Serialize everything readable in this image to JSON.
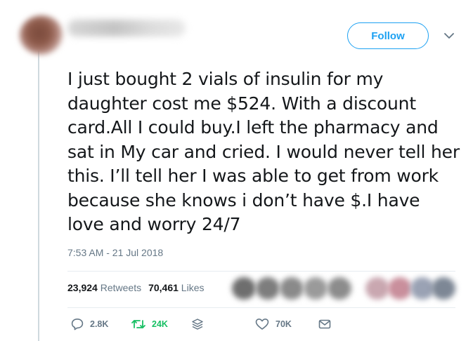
{
  "header": {
    "follow_label": "Follow"
  },
  "tweet": {
    "text": "I just bought 2 vials of insulin for my daughter cost me $524. With a discount card.All I could buy.I left the pharmacy and sat in My car and cried. I would never tell her this. I’ll  tell her I was able to get from work because she knows i don’t have $.I have love and worry 24/7",
    "timestamp": "7:53 AM - 21 Jul 2018"
  },
  "stats": {
    "retweets_count": "23,924",
    "retweets_label": "Retweets",
    "likes_count": "70,461",
    "likes_label": "Likes"
  },
  "actions": {
    "reply_count": "2.8K",
    "retweet_count": "24K",
    "like_count": "70K"
  },
  "icons": {
    "reply": "reply-icon",
    "retweet": "retweet-icon",
    "stack": "stack-icon",
    "like": "heart-icon",
    "dm": "envelope-icon",
    "more": "chevron-down-icon"
  },
  "colors": {
    "accent": "#1da1f2",
    "retweet_active": "#17bf63",
    "muted_text": "#657786",
    "main_text": "#14171a"
  }
}
